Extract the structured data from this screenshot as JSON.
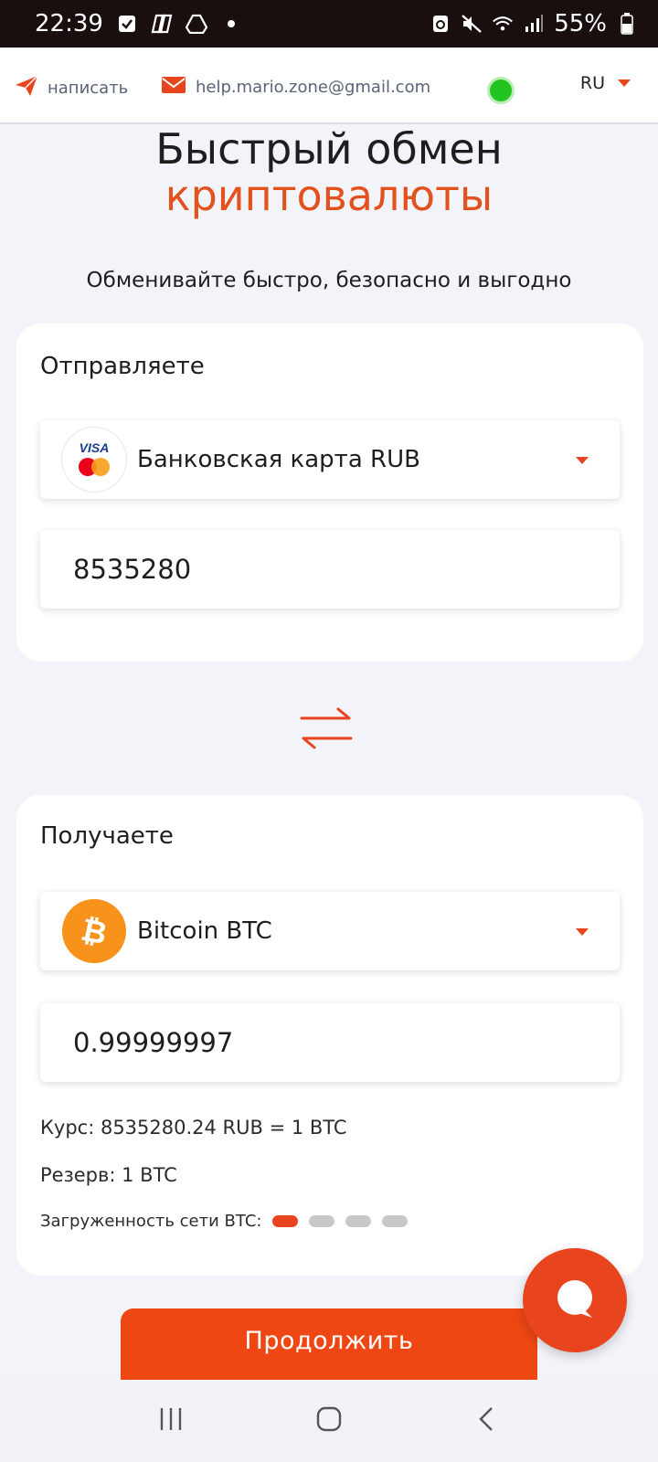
{
  "status_bar": {
    "time": "22:39",
    "battery": "55%",
    "icons": [
      "check-box-icon",
      "copilot-icon",
      "drive-icon",
      "dot-icon",
      "recycle-icon",
      "mute-icon",
      "wifi-icon",
      "signal-icon",
      "battery-icon"
    ]
  },
  "topbar": {
    "write_label": "написать",
    "email": "help.mario.zone@gmail.com",
    "lang": "RU",
    "online_color": "#22c41f"
  },
  "hero": {
    "title_line1": "Быстрый обмен",
    "title_line2": "криптовалюты",
    "subtitle": "Обменивайте быстро, безопасно и выгодно"
  },
  "send": {
    "label": "Отправляете",
    "currency": "Банковская карта RUB",
    "amount": "8535280"
  },
  "receive": {
    "label": "Получаете",
    "currency": "Bitcoin BTC",
    "amount": "0.99999997",
    "rate": "Курс: 8535280.24 RUB = 1 BTC",
    "reserve": "Резерв: 1 BTC",
    "network_load_label": "Загруженность сети BTC:",
    "network_load_level": 1,
    "network_load_max": 4
  },
  "actions": {
    "continue_label": "Продолжить"
  },
  "colors": {
    "accent": "#e8451e",
    "button": "#ef4714",
    "bitcoin": "#f7931a"
  }
}
